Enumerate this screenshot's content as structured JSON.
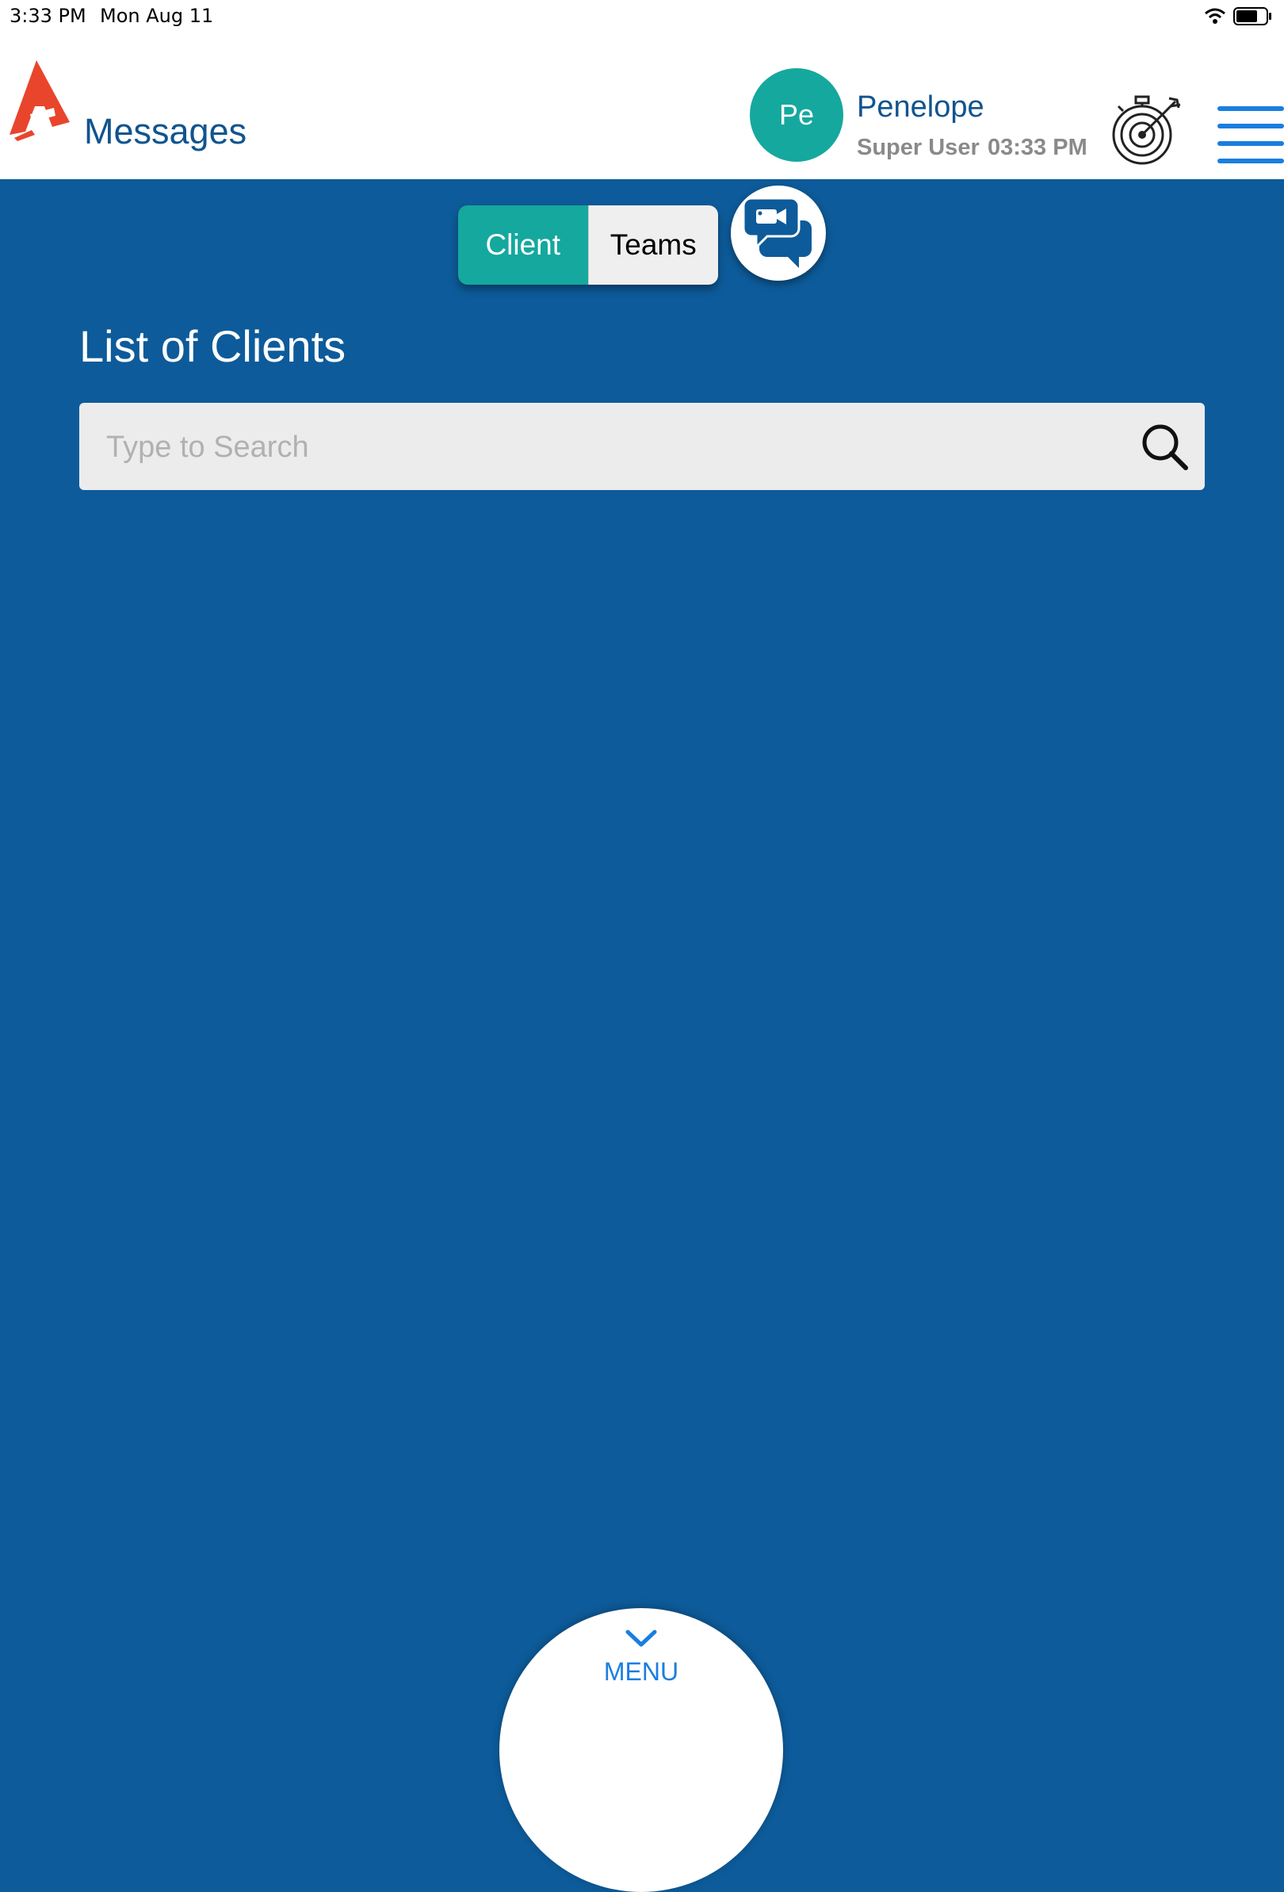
{
  "status_bar": {
    "time": "3:33 PM",
    "date": "Mon Aug 11"
  },
  "header": {
    "title": "Messages",
    "user": {
      "initials": "Pe",
      "name": "Penelope",
      "role": "Super User",
      "time": "03:33 PM"
    }
  },
  "segmented": {
    "client_label": "Client",
    "teams_label": "Teams",
    "selected": "Client"
  },
  "main": {
    "heading": "List of Clients",
    "search": {
      "placeholder": "Type to Search",
      "value": ""
    }
  },
  "menu": {
    "label": "MENU"
  },
  "colors": {
    "background": "#0d5b9a",
    "accent": "#15a89e",
    "brand": "#10548f",
    "logo": "#e8452c",
    "menu_link": "#1a7ee0"
  },
  "icons": [
    "wifi-icon",
    "battery-icon",
    "app-logo-icon",
    "target-timer-icon",
    "hamburger-menu-icon",
    "video-chat-icon",
    "search-icon",
    "chevron-down-icon"
  ]
}
